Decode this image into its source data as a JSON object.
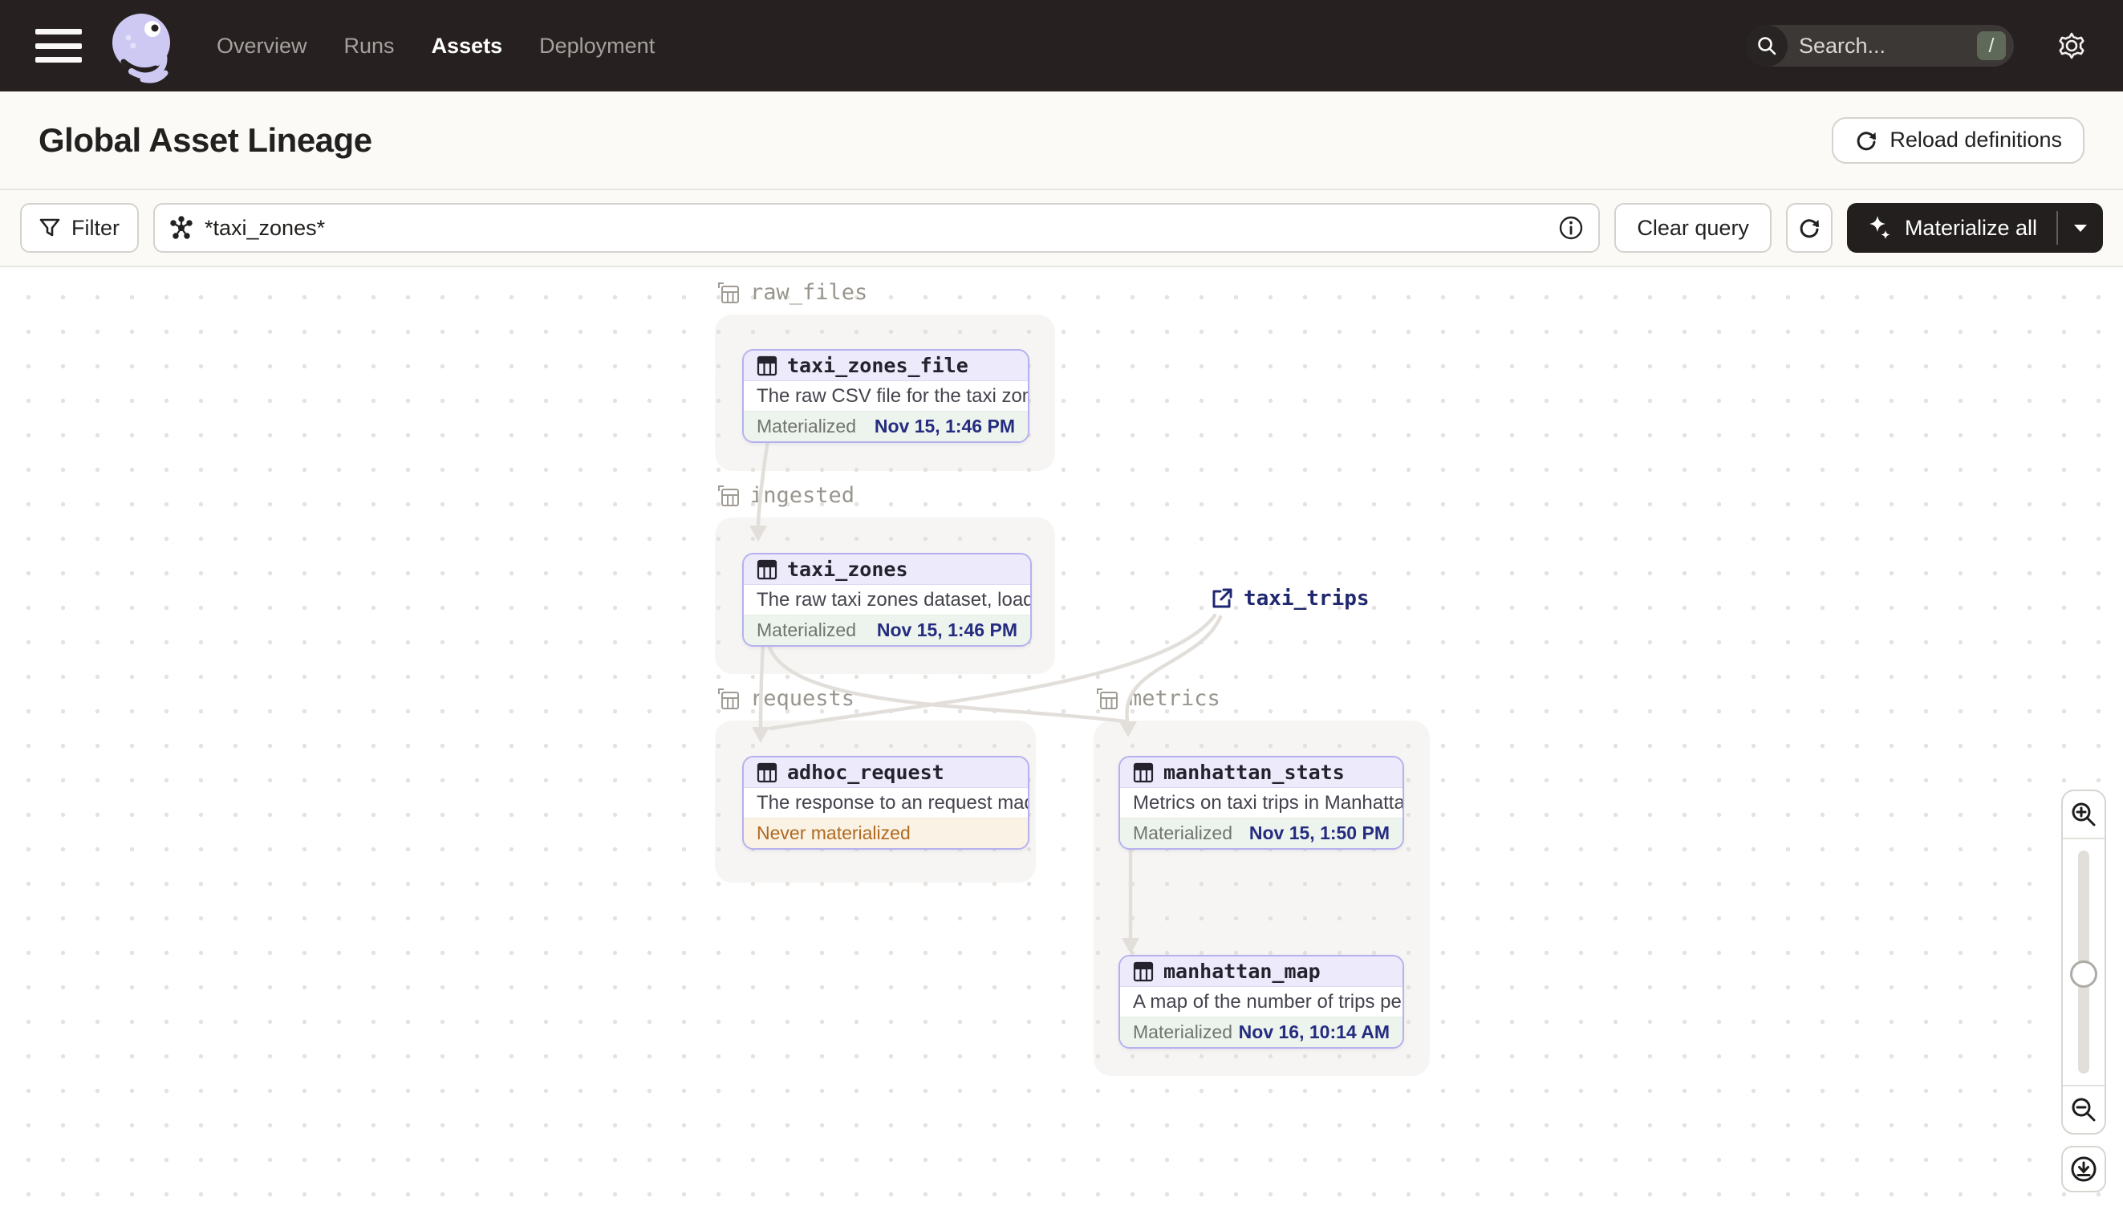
{
  "nav": {
    "items": [
      {
        "label": "Overview",
        "active": false
      },
      {
        "label": "Runs",
        "active": false
      },
      {
        "label": "Assets",
        "active": true
      },
      {
        "label": "Deployment",
        "active": false
      }
    ],
    "search_placeholder": "Search...",
    "search_shortcut": "/"
  },
  "header": {
    "title": "Global Asset Lineage",
    "reload_label": "Reload definitions"
  },
  "toolbar": {
    "filter_label": "Filter",
    "query_value": "*taxi_zones*",
    "clear_label": "Clear query",
    "materialize_label": "Materialize all"
  },
  "canvas": {
    "groups": [
      {
        "name": "raw_files"
      },
      {
        "name": "ingested"
      },
      {
        "name": "requests"
      },
      {
        "name": "metrics"
      }
    ],
    "assets": [
      {
        "name": "taxi_zones_file",
        "description": "The raw CSV file for the taxi zones dat...",
        "status": "Materialized",
        "timestamp": "Nov 15, 1:46 PM"
      },
      {
        "name": "taxi_zones",
        "description": "The raw taxi zones dataset, loaded int...",
        "status": "Materialized",
        "timestamp": "Nov 15, 1:46 PM"
      },
      {
        "name": "adhoc_request",
        "description": "The response to an request made in th...",
        "status": "Never materialized",
        "timestamp": ""
      },
      {
        "name": "manhattan_stats",
        "description": "Metrics on taxi trips in Manhattan",
        "status": "Materialized",
        "timestamp": "Nov 15, 1:50 PM"
      },
      {
        "name": "manhattan_map",
        "description": "A map of the number of trips per taxi z...",
        "status": "Materialized",
        "timestamp": "Nov 16, 10:14 AM"
      }
    ],
    "external_asset": {
      "name": "taxi_trips"
    }
  },
  "colors": {
    "nav_background": "#262120",
    "node_border": "#B6B1EE",
    "node_header_background": "#ECEAFB",
    "materialized_background": "#EDF4ED",
    "materialized_timestamp": "#252C80",
    "never_materialized_text": "#B06A20",
    "edge": "#E2DFDB",
    "external_asset_text": "#1F276F"
  }
}
